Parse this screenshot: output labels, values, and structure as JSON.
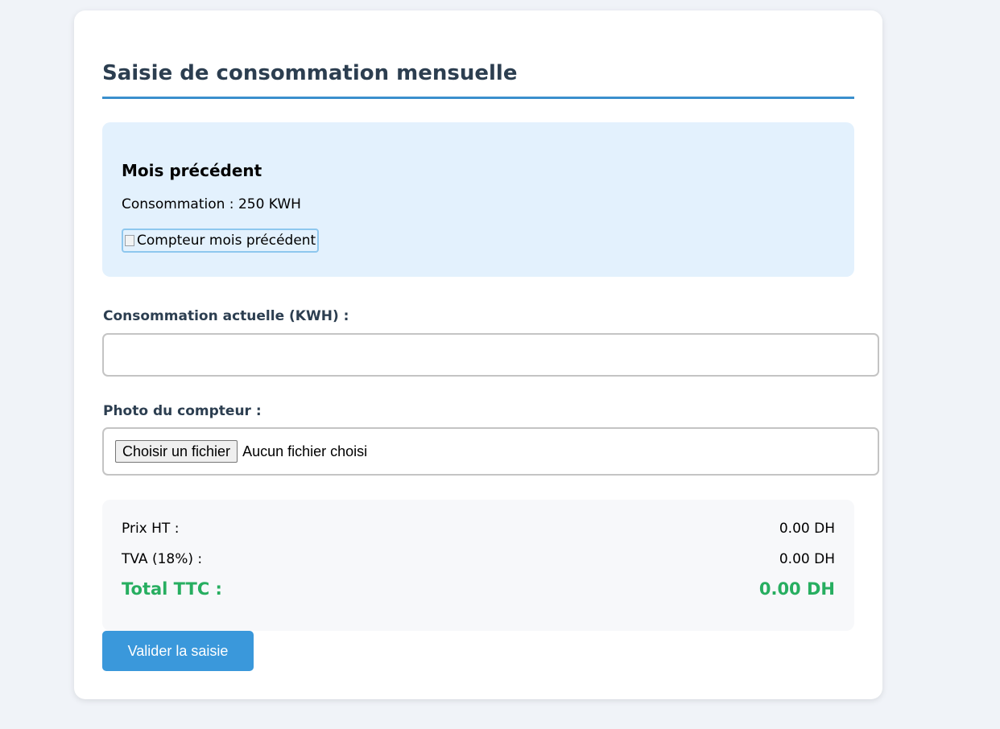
{
  "form": {
    "title": "Saisie de consommation mensuelle",
    "previous": {
      "title": "Mois précédent",
      "consumption_text": "Consommation : 250 KWH",
      "photo_alt": "Compteur mois précédent"
    },
    "current_consumption": {
      "label": "Consommation actuelle (KWH) :",
      "value": "",
      "placeholder": ""
    },
    "meter_photo": {
      "label": "Photo du compteur :",
      "button_label": "Choisir un fichier",
      "status": "Aucun fichier choisi"
    },
    "summary": {
      "price_ht_label": "Prix HT :",
      "price_ht_value": "0.00 DH",
      "tva_label": "TVA (18%) :",
      "tva_value": "0.00 DH",
      "total_label": "Total TTC :",
      "total_value": "0.00 DH"
    },
    "submit_label": "Valider la saisie"
  },
  "colors": {
    "accent": "#3a98db",
    "title": "#2c3e50",
    "total": "#27ae60",
    "info_bg": "#e3f1fd"
  }
}
